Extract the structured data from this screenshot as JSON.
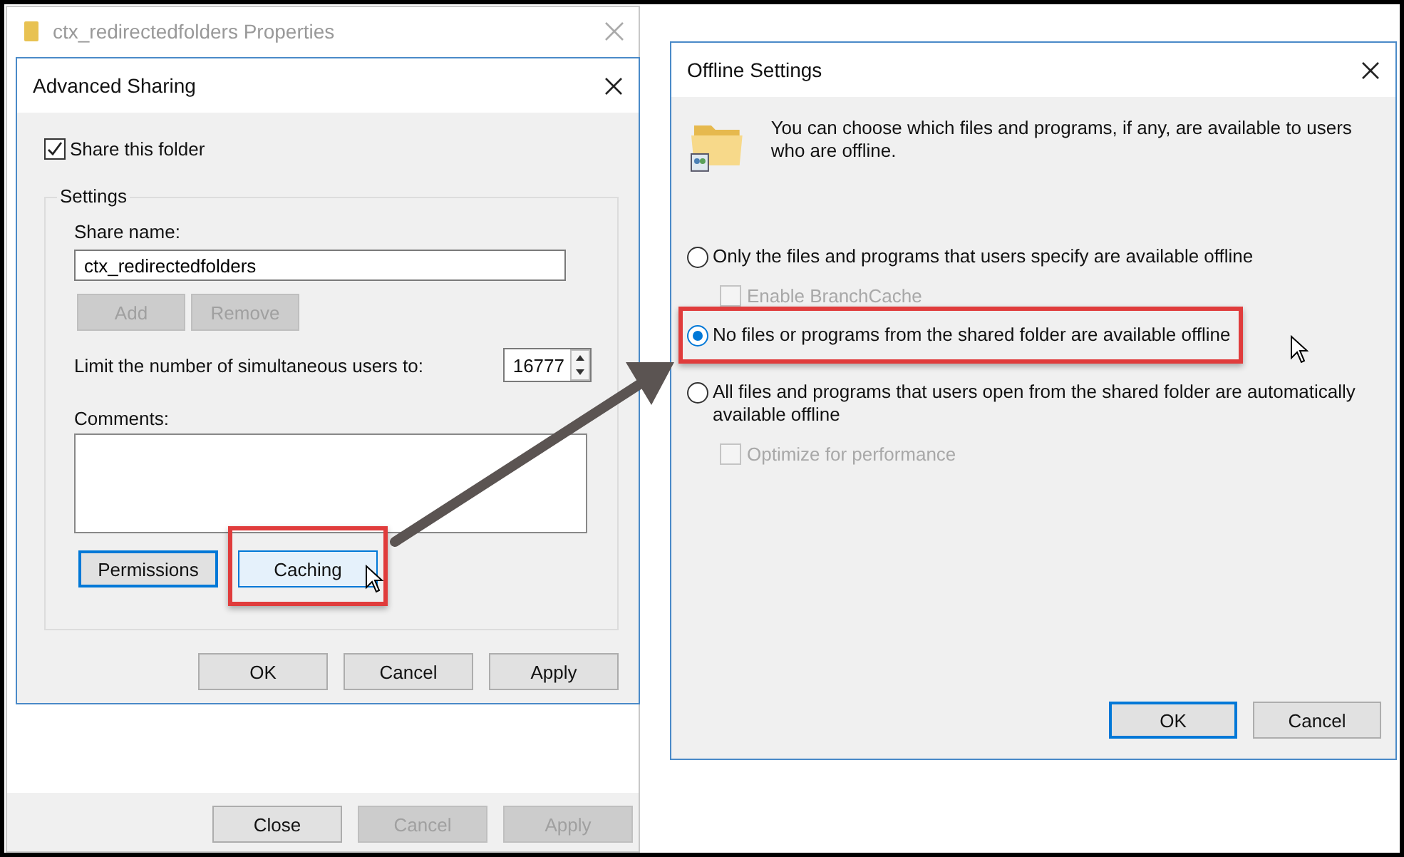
{
  "properties_window": {
    "title": "ctx_redirectedfolders Properties",
    "buttons": [
      {
        "label": "Close",
        "disabled": false
      },
      {
        "label": "Cancel",
        "disabled": true
      },
      {
        "label": "Apply",
        "disabled": true
      }
    ]
  },
  "advanced_sharing": {
    "title": "Advanced Sharing",
    "share_checkbox": {
      "label": "Share this folder",
      "checked": true
    },
    "group_label": "Settings",
    "share_name_label": "Share name:",
    "share_name": "ctx_redirectedfolders",
    "name_buttons": [
      {
        "label": "Add",
        "disabled": true
      },
      {
        "label": "Remove",
        "disabled": true
      }
    ],
    "limit_label": "Limit the number of simultaneous users to:",
    "limit_value": "16777",
    "comments_label": "Comments:",
    "action_buttons": [
      {
        "label": "Permissions",
        "focused": true,
        "hovered": false,
        "highlighted": false
      },
      {
        "label": "Caching",
        "focused": false,
        "hovered": true,
        "highlighted": true
      }
    ],
    "buttons": [
      {
        "label": "OK",
        "focused": false
      },
      {
        "label": "Cancel",
        "focused": false
      },
      {
        "label": "Apply",
        "focused": false
      }
    ]
  },
  "offline_settings": {
    "title": "Offline Settings",
    "description": "You can choose which files and programs, if any, are available to users who are offline.",
    "options": [
      {
        "kind": "radio",
        "label": "Only the files and programs that users specify are available offline",
        "selected": false,
        "highlighted": false
      },
      {
        "kind": "checkbox",
        "label": "Enable BranchCache",
        "checked": false,
        "disabled": true
      },
      {
        "kind": "radio",
        "label": "No files or programs from the shared folder are available offline",
        "selected": true,
        "highlighted": true
      },
      {
        "kind": "radio",
        "label": "All files and programs that users open from the shared folder are automatically available offline",
        "selected": false,
        "highlighted": false
      },
      {
        "kind": "checkbox",
        "label": "Optimize for performance",
        "checked": false,
        "disabled": true
      }
    ],
    "buttons": [
      {
        "label": "OK",
        "focused": true
      },
      {
        "label": "Cancel",
        "focused": false
      }
    ]
  }
}
